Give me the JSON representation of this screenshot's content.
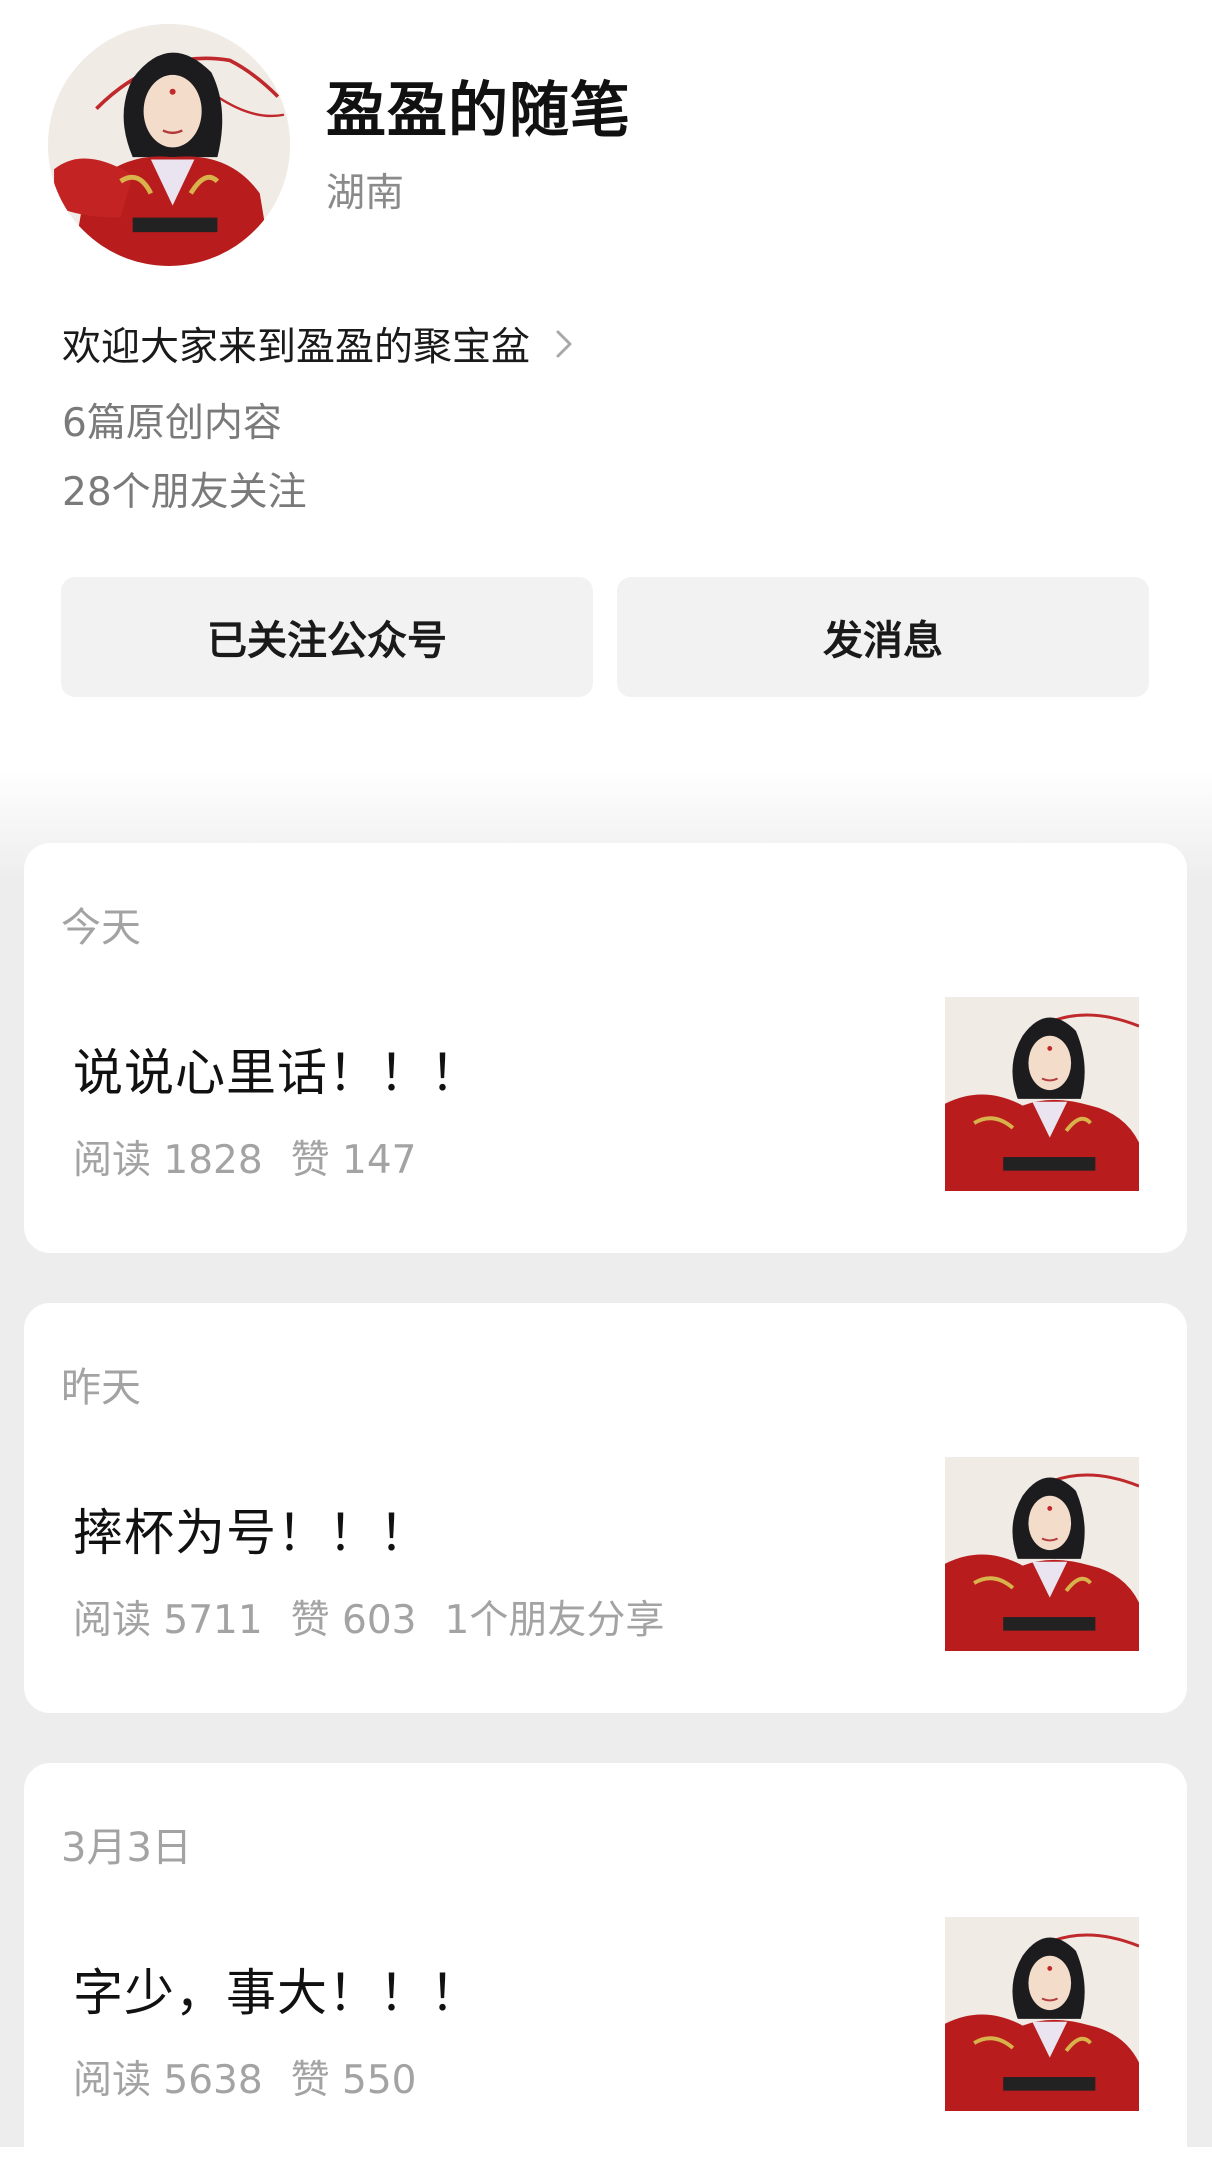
{
  "profile": {
    "name": "盈盈的随笔",
    "location": "湖南",
    "intro": "欢迎大家来到盈盈的聚宝盆",
    "articles_count_text": "6篇原创内容",
    "friends_following_text": "28个朋友关注",
    "avatar_icon": "woman-in-red-hanfu-illustration"
  },
  "actions": {
    "follow_label": "已关注公众号",
    "message_label": "发消息"
  },
  "articles": [
    {
      "date": "今天",
      "title": "说说心里话！！！",
      "reads": "阅读 1828",
      "likes": "赞 147",
      "shares": ""
    },
    {
      "date": "昨天",
      "title": "摔杯为号！！！",
      "reads": "阅读 5711",
      "likes": "赞 603",
      "shares": "1个朋友分享"
    },
    {
      "date": "3月3日",
      "title": "字少，事大！！！",
      "reads": "阅读 5638",
      "likes": "赞 550",
      "shares": ""
    }
  ],
  "colors": {
    "background": "#ededed",
    "card": "#ffffff",
    "button": "#f2f2f2",
    "secondary_text": "#a3a3a3",
    "robe_red": "#b81c1c"
  }
}
